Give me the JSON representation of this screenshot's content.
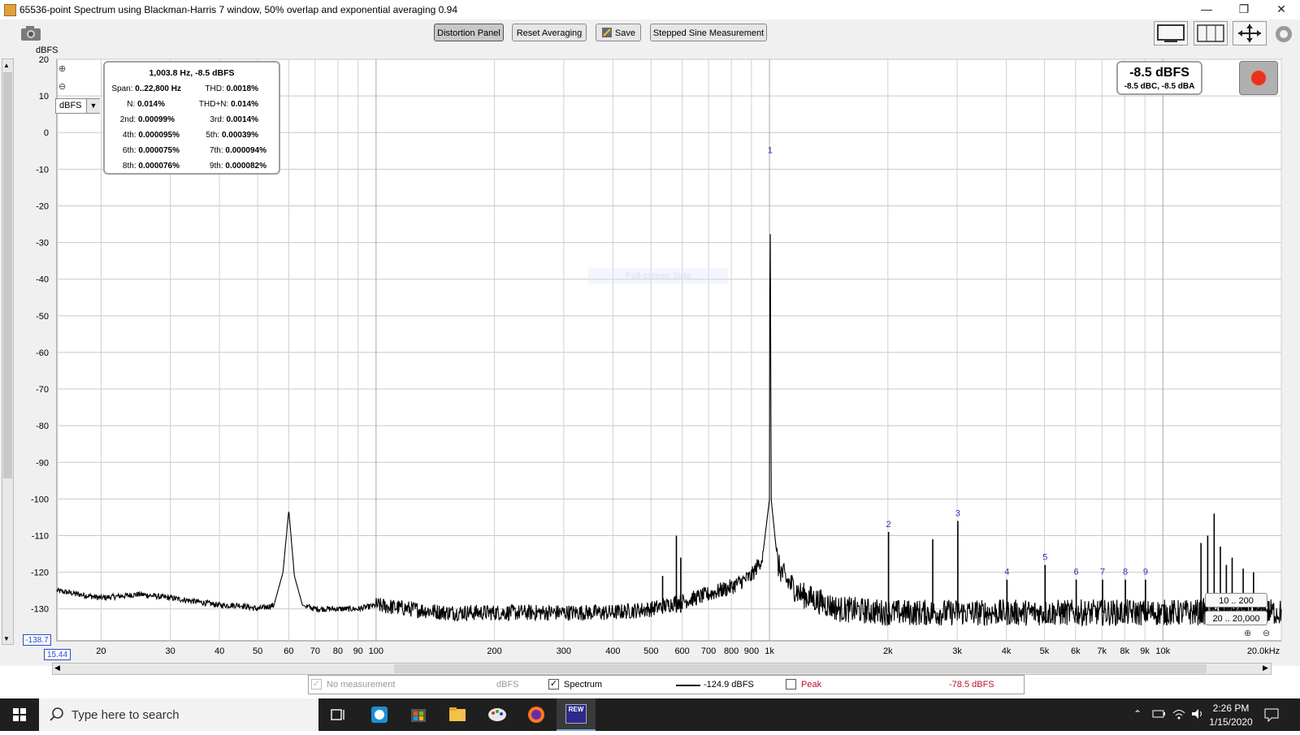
{
  "window": {
    "title": "65536-point Spectrum using Blackman-Harris 7 window, 50% overlap and exponential averaging 0.94",
    "minimize": "—",
    "maximize": "❐",
    "close": "✕"
  },
  "toolbar": {
    "distortion_panel": "Distortion Panel",
    "reset_averaging": "Reset Averaging",
    "save": "Save",
    "stepped_sine": "Stepped Sine Measurement"
  },
  "plot": {
    "y_unit": "dBFS",
    "unit_select": "dBFS",
    "y_min_value": "-138.7",
    "x_min_value": "15.44",
    "watermark": "Full-screen Side",
    "range_btn_1": "10 .. 200",
    "range_btn_2": "20 .. 20,000",
    "y_ticks": [
      "20",
      "10",
      "0",
      "-10",
      "-20",
      "-30",
      "-40",
      "-50",
      "-60",
      "-70",
      "-80",
      "-90",
      "-100",
      "-110",
      "-120",
      "-130"
    ],
    "x_ticks": [
      "20",
      "30",
      "40",
      "50",
      "60",
      "70",
      "80",
      "90",
      "100",
      "200",
      "300",
      "400",
      "500",
      "600",
      "700",
      "800",
      "900",
      "1k",
      "2k",
      "3k",
      "4k",
      "5k",
      "6k",
      "7k",
      "8k",
      "9k",
      "10k",
      "20.0kHz"
    ],
    "harmonic_markers": [
      "1",
      "2",
      "3",
      "4",
      "5",
      "6",
      "7",
      "8",
      "9"
    ]
  },
  "chart_data": {
    "type": "line",
    "xlabel": "",
    "ylabel": "dBFS",
    "x_scale": "log",
    "xlim": [
      15.44,
      20000
    ],
    "ylim": [
      -138.7,
      20
    ],
    "grid": true,
    "series": [
      {
        "name": "Spectrum",
        "x": [
          15.44,
          20,
          25,
          30,
          35,
          40,
          45,
          50,
          55,
          58,
          60,
          62,
          65,
          70,
          80,
          90,
          100,
          150,
          200,
          300,
          400,
          500,
          550,
          580,
          600,
          650,
          700,
          800,
          900,
          960,
          1000,
          1003.8,
          1010,
          1050,
          1100,
          1200,
          1500,
          2000,
          2500,
          3000,
          4000,
          5000,
          6000,
          8000,
          10000,
          12000,
          15000,
          20000
        ],
        "y": [
          -125,
          -127,
          -126,
          -127,
          -128,
          -129,
          -129,
          -130,
          -129,
          -120,
          -103,
          -121,
          -129,
          -130,
          -130,
          -130,
          -129,
          -131,
          -131,
          -131,
          -131,
          -130,
          -129,
          -128,
          -128,
          -127,
          -126,
          -124,
          -121,
          -116,
          -100,
          -8.5,
          -100,
          -118,
          -122,
          -126,
          -130,
          -131,
          -131,
          -131,
          -131,
          -131,
          -131,
          -131,
          -131,
          -131,
          -130,
          -131
        ]
      }
    ],
    "peaks": [
      {
        "label": "1",
        "x": 1003.8,
        "y": -8.5
      },
      {
        "label": "2",
        "x": 2007.6,
        "y": -109
      },
      {
        "label": "3",
        "x": 3011.4,
        "y": -106
      },
      {
        "label": "4",
        "x": 4015.2,
        "y": -122
      },
      {
        "label": "5",
        "x": 5019,
        "y": -118
      },
      {
        "label": "6",
        "x": 6022.8,
        "y": -122
      },
      {
        "label": "7",
        "x": 7026.6,
        "y": -122
      },
      {
        "label": "8",
        "x": 8030.4,
        "y": -122
      },
      {
        "label": "9",
        "x": 9034.2,
        "y": -122
      }
    ],
    "spurs": [
      {
        "x": 535,
        "y": -121
      },
      {
        "x": 580,
        "y": -110
      },
      {
        "x": 595,
        "y": -116
      },
      {
        "x": 2600,
        "y": -111
      },
      {
        "x": 12500,
        "y": -112
      },
      {
        "x": 13000,
        "y": -110
      },
      {
        "x": 13500,
        "y": -104
      },
      {
        "x": 14000,
        "y": -113
      },
      {
        "x": 14500,
        "y": -118
      },
      {
        "x": 15000,
        "y": -116
      },
      {
        "x": 16000,
        "y": -119
      },
      {
        "x": 17000,
        "y": -120
      }
    ]
  },
  "distortion": {
    "header": "1,003.8 Hz, -8.5 dBFS",
    "span_label": "Span:",
    "span_value": "0..22,800 Hz",
    "thd_label": "THD:",
    "thd_value": "0.0018%",
    "n_label": "N:",
    "n_value": "0.014%",
    "thdn_label": "THD+N:",
    "thdn_value": "0.014%",
    "h2_label": "2nd:",
    "h2_value": "0.00099%",
    "h3_label": "3rd:",
    "h3_value": "0.0014%",
    "h4_label": "4th:",
    "h4_value": "0.000095%",
    "h5_label": "5th:",
    "h5_value": "0.00039%",
    "h6_label": "6th:",
    "h6_value": "0.000075%",
    "h7_label": "7th:",
    "h7_value": "0.000094%",
    "h8_label": "8th:",
    "h8_value": "0.000076%",
    "h9_label": "9th:",
    "h9_value": "0.000082%"
  },
  "level": {
    "main": "-8.5 dBFS",
    "sub": "-8.5 dBC, -8.5 dBA"
  },
  "legend": {
    "no_measurement": "No measurement",
    "no_measurement_unit": "dBFS",
    "spectrum": "Spectrum",
    "spectrum_value": "-124.9 dBFS",
    "peak": "Peak",
    "peak_value": "-78.5 dBFS"
  },
  "taskbar": {
    "search_placeholder": "Type here to search",
    "time": "2:26 PM",
    "date": "1/15/2020",
    "rew_label": "REW"
  },
  "colors": {
    "trace": "#000000",
    "grid": "#c8c8c8",
    "marker": "#2a36b8",
    "peak_text": "#c0102a",
    "taskbar": "#1f1f1f"
  }
}
